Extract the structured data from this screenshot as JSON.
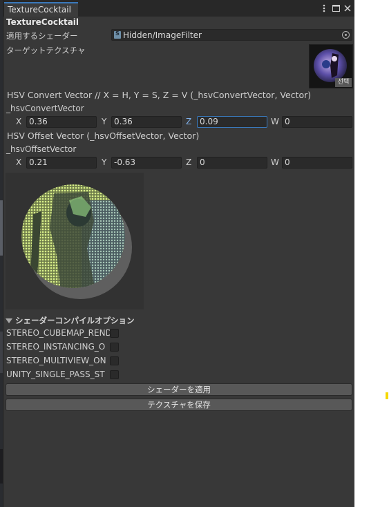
{
  "window": {
    "tab_title": "TextureCocktail",
    "menu_icon": "kebab-icon",
    "maximize_icon": "maximize-icon",
    "close_icon": "close-icon"
  },
  "header": {
    "title": "TextureCocktail"
  },
  "shader": {
    "label": "適用するシェーダー",
    "value": "Hidden/ImageFilter"
  },
  "target_texture": {
    "label": "ターゲットテクスチャ",
    "select_label": "선택"
  },
  "hsv_convert": {
    "heading": "HSV Convert Vector // X = H, Y = S, Z = V (_hsvConvertVector, Vector)",
    "property": "_hsvConvertVector",
    "x": "0.36",
    "y": "0.36",
    "z": "0.09",
    "w": "0"
  },
  "hsv_offset": {
    "heading": "HSV Offset Vector (_hsvOffsetVector, Vector)",
    "property": "_hsvOffsetVector",
    "x": "0.21",
    "y": "-0.63",
    "z": "0",
    "w": "0"
  },
  "axis": {
    "x": "X",
    "y": "Y",
    "z": "Z",
    "w": "W"
  },
  "compile_options": {
    "title": "シェーダーコンパイルオプション",
    "items": [
      "STEREO_CUBEMAP_REND",
      "STEREO_INSTANCING_O",
      "STEREO_MULTIVIEW_ON",
      "UNITY_SINGLE_PASS_ST"
    ]
  },
  "buttons": {
    "apply": "シェーダーを適用",
    "save": "テクスチャを保存"
  },
  "colors": {
    "panel": "#383838",
    "field": "#2a2a2a",
    "accent": "#3a79bb",
    "marker": "#f5d800"
  }
}
